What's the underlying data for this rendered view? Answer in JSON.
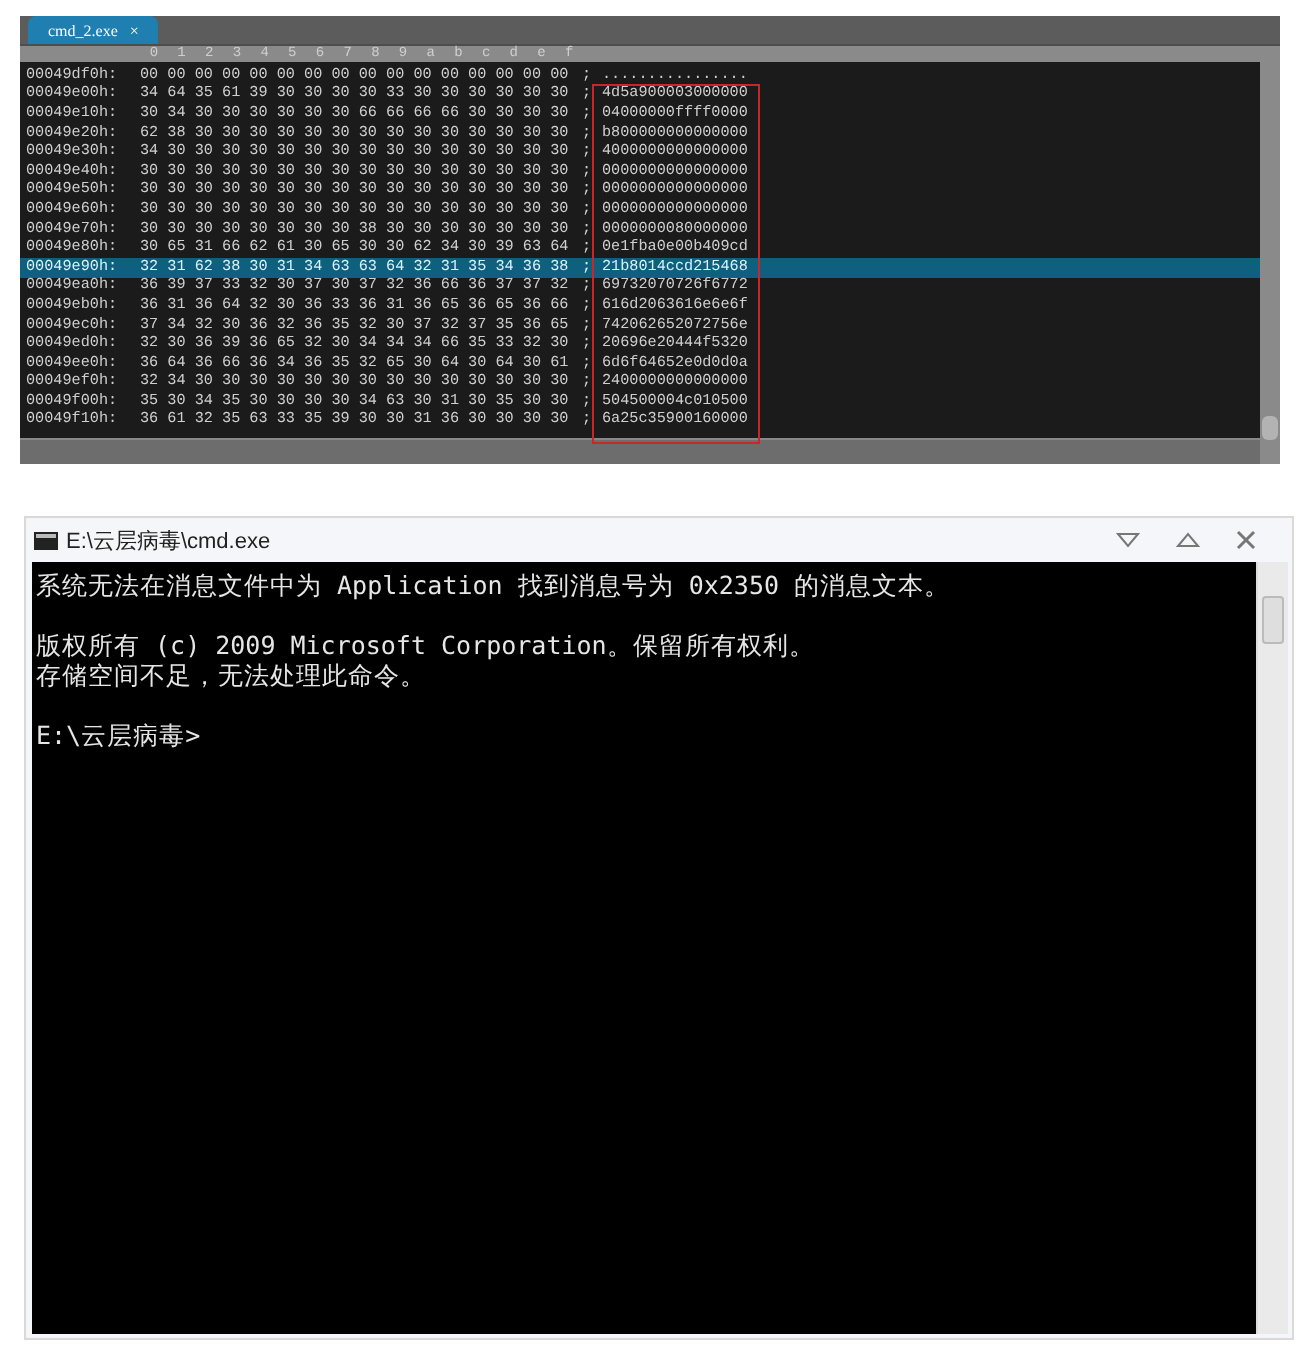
{
  "hex_editor": {
    "tab": {
      "label": "cmd_2.exe",
      "close": "×",
      "selected": true
    },
    "header": [
      "0",
      "1",
      "2",
      "3",
      "4",
      "5",
      "6",
      "7",
      "8",
      "9",
      "a",
      "b",
      "c",
      "d",
      "e",
      "f"
    ],
    "rows": [
      {
        "offset": "00049df0h:",
        "bytes": "00 00 00 00 00 00 00 00 00 00 00 00 00 00 00 00",
        "separator": ";",
        "ascii": "................",
        "selected": false
      },
      {
        "offset": "00049e00h:",
        "bytes": "34 64 35 61 39 30 30 30 30 33 30 30 30 30 30 30",
        "separator": ";",
        "ascii": "4d5a900003000000",
        "selected": false
      },
      {
        "offset": "00049e10h:",
        "bytes": "30 34 30 30 30 30 30 30 66 66 66 66 30 30 30 30",
        "separator": ";",
        "ascii": "04000000ffff0000",
        "selected": false
      },
      {
        "offset": "00049e20h:",
        "bytes": "62 38 30 30 30 30 30 30 30 30 30 30 30 30 30 30",
        "separator": ";",
        "ascii": "b800000000000000",
        "selected": false
      },
      {
        "offset": "00049e30h:",
        "bytes": "34 30 30 30 30 30 30 30 30 30 30 30 30 30 30 30",
        "separator": ";",
        "ascii": "4000000000000000",
        "selected": false
      },
      {
        "offset": "00049e40h:",
        "bytes": "30 30 30 30 30 30 30 30 30 30 30 30 30 30 30 30",
        "separator": ";",
        "ascii": "0000000000000000",
        "selected": false
      },
      {
        "offset": "00049e50h:",
        "bytes": "30 30 30 30 30 30 30 30 30 30 30 30 30 30 30 30",
        "separator": ";",
        "ascii": "0000000000000000",
        "selected": false
      },
      {
        "offset": "00049e60h:",
        "bytes": "30 30 30 30 30 30 30 30 30 30 30 30 30 30 30 30",
        "separator": ";",
        "ascii": "0000000000000000",
        "selected": false
      },
      {
        "offset": "00049e70h:",
        "bytes": "30 30 30 30 30 30 30 30 38 30 30 30 30 30 30 30",
        "separator": ";",
        "ascii": "0000000080000000",
        "selected": false
      },
      {
        "offset": "00049e80h:",
        "bytes": "30 65 31 66 62 61 30 65 30 30 62 34 30 39 63 64",
        "separator": ";",
        "ascii": "0e1fba0e00b409cd",
        "selected": false
      },
      {
        "offset": "00049e90h:",
        "bytes": "32 31 62 38 30 31 34 63 63 64 32 31 35 34 36 38",
        "separator": ";",
        "ascii": "21b8014ccd215468",
        "selected": true
      },
      {
        "offset": "00049ea0h:",
        "bytes": "36 39 37 33 32 30 37 30 37 32 36 66 36 37 37 32",
        "separator": ";",
        "ascii": "69732070726f6772",
        "selected": false
      },
      {
        "offset": "00049eb0h:",
        "bytes": "36 31 36 64 32 30 36 33 36 31 36 65 36 65 36 66",
        "separator": ";",
        "ascii": "616d2063616e6e6f",
        "selected": false
      },
      {
        "offset": "00049ec0h:",
        "bytes": "37 34 32 30 36 32 36 35 32 30 37 32 37 35 36 65",
        "separator": ";",
        "ascii": "742062652072756e",
        "selected": false
      },
      {
        "offset": "00049ed0h:",
        "bytes": "32 30 36 39 36 65 32 30 34 34 34 66 35 33 32 30",
        "separator": ";",
        "ascii": "20696e20444f5320",
        "selected": false
      },
      {
        "offset": "00049ee0h:",
        "bytes": "36 64 36 66 36 34 36 35 32 65 30 64 30 64 30 61",
        "separator": ";",
        "ascii": "6d6f64652e0d0d0a",
        "selected": false
      },
      {
        "offset": "00049ef0h:",
        "bytes": "32 34 30 30 30 30 30 30 30 30 30 30 30 30 30 30",
        "separator": ";",
        "ascii": "2400000000000000",
        "selected": false
      },
      {
        "offset": "00049f00h:",
        "bytes": "35 30 34 35 30 30 30 30 34 63 30 31 30 35 30 30",
        "separator": ";",
        "ascii": "504500004c010500",
        "selected": false
      },
      {
        "offset": "00049f10h:",
        "bytes": "36 61 32 35 63 33 35 39 30 30 31 36 30 30 30 30",
        "separator": ";",
        "ascii": "6a25c35900160000",
        "selected": false
      }
    ]
  },
  "cmd_window": {
    "title": "E:\\云层病毒\\cmd.exe",
    "paragraphs": [
      [
        "系统无法在消息文件中为 Application 找到消息号为 0x2350 的消息文本。"
      ],
      [
        "版权所有 (c) 2009 Microsoft Corporation。保留所有权利。",
        "存储空间不足，无法处理此命令。"
      ],
      [
        "E:\\云层病毒>"
      ]
    ]
  }
}
